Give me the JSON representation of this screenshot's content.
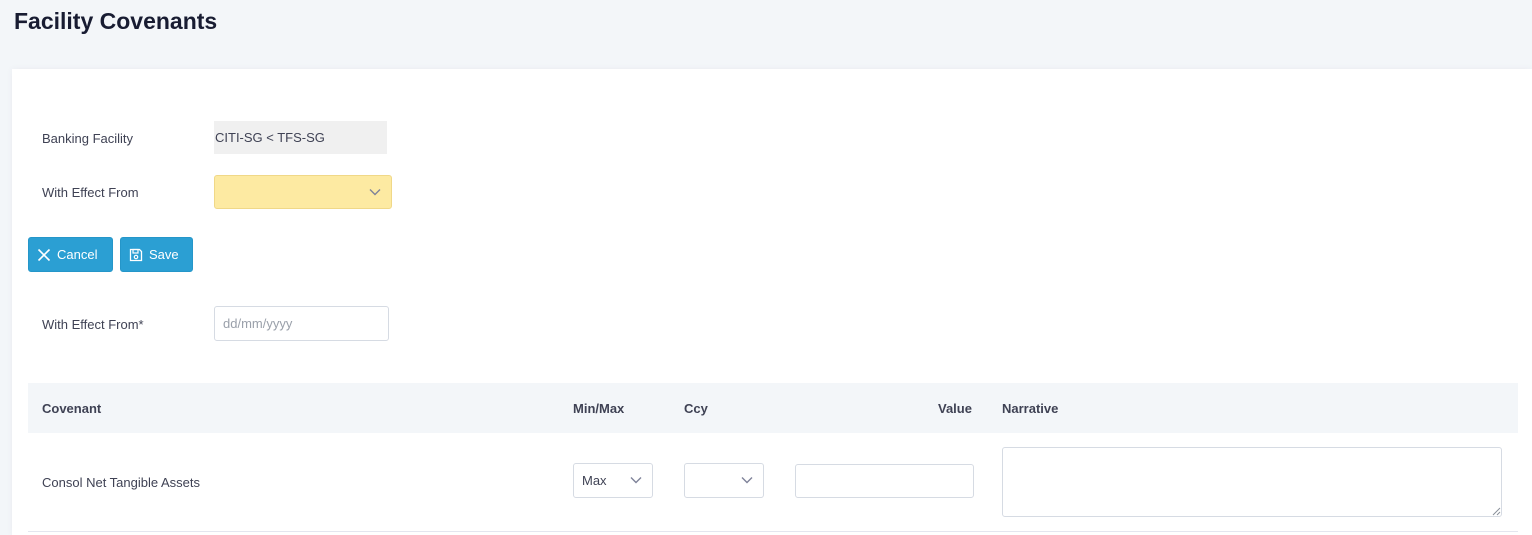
{
  "page": {
    "title": "Facility Covenants"
  },
  "form": {
    "banking_facility_label": "Banking Facility",
    "banking_facility_value": "CITI-SG < TFS-SG",
    "with_effect_from_label": "With Effect From",
    "with_effect_from_selected": "",
    "new_with_effect_from_label": "With Effect From*",
    "date_placeholder": "dd/mm/yyyy"
  },
  "buttons": {
    "cancel": "Cancel",
    "save": "Save"
  },
  "table": {
    "headers": {
      "covenant": "Covenant",
      "minmax": "Min/Max",
      "ccy": "Ccy",
      "value": "Value",
      "narrative": "Narrative"
    },
    "rows": [
      {
        "covenant": "Consol Net Tangible Assets",
        "minmax": "Max",
        "ccy": "",
        "value": "",
        "narrative": ""
      }
    ]
  },
  "colors": {
    "primary_button": "#2b9fd3",
    "highlight_select": "#fdeaa2",
    "page_background": "#f3f6f9"
  },
  "icons": {
    "cancel": "close-icon",
    "save": "save-icon",
    "dropdown": "chevron-down-icon"
  }
}
